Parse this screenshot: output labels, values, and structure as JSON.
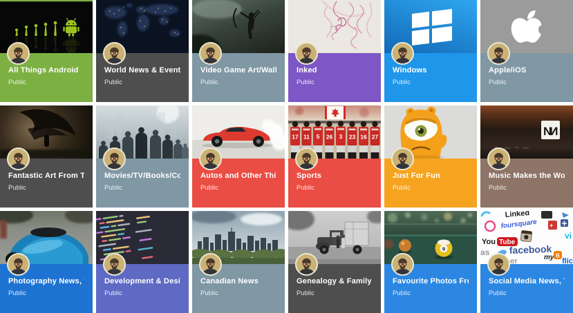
{
  "page": {
    "background": "#ffffff",
    "kind": "collections-grid"
  },
  "labels": {
    "visibility_public": "Public"
  },
  "avatar": {
    "alt": "profile photo of a man with glasses and beard"
  },
  "cards": [
    {
      "title": "All Things Android",
      "visibility": "Public",
      "accent": "#7CB043",
      "image_desc": "black wallpaper with green human-evolution silhouettes ending in Android robot"
    },
    {
      "title": "World News & Events",
      "visibility": "Public",
      "accent": "#4E4E4E",
      "image_desc": "dark world map at night with city lights"
    },
    {
      "title": "Video Game Art/Wallpapers",
      "visibility": "Public",
      "accent": "#8097A4",
      "image_desc": "Tomb Raider game art, heroine with bow in misty ruins"
    },
    {
      "title": "Inked",
      "visibility": "Public",
      "accent": "#7D57C5",
      "image_desc": "pink tattoo sketch line art on pale paper"
    },
    {
      "title": "Windows",
      "visibility": "Public",
      "accent": "#1F96EA",
      "image_desc": "white Windows logo on blue background"
    },
    {
      "title": "Apple/iOS",
      "visibility": "Public",
      "accent": "#8097A4",
      "image_desc": "white Apple logo on gray background"
    },
    {
      "title": "Fantastic Art From Talented...",
      "visibility": "Public",
      "accent": "#4E4E4E",
      "image_desc": "dark fantasy art of winged creature"
    },
    {
      "title": "Movies/TV/Books/Comics",
      "visibility": "Public",
      "accent": "#8097A4",
      "image_desc": "movie cast lineup against hazy city skyline"
    },
    {
      "title": "Autos and Other Things Tha...",
      "visibility": "Public",
      "accent": "#EA4D44",
      "image_desc": "red muscle car doing a burnout on white background"
    },
    {
      "title": "Sports",
      "visibility": "Public",
      "accent": "#EA4D44",
      "image_desc": "hockey team in red jerseys facing away under a Canada flag",
      "jersey_numbers": [
        "17",
        "11",
        "5",
        "26",
        "3",
        "23",
        "16",
        "27"
      ]
    },
    {
      "title": "Just For Fun",
      "visibility": "Public",
      "accent": "#F6A41F",
      "image_desc": "orange one-eyed monster toy"
    },
    {
      "title": "Music Makes the World Go '...",
      "visibility": "Public",
      "accent": "#8D7466",
      "image_desc": "dark textured album art with white NIN logo square",
      "logo_letter": "N"
    },
    {
      "title": "Photography News, Tips, & ...",
      "visibility": "Public",
      "accent": "#1E73D2",
      "image_desc": "fisheye photo of glossy blue sports car"
    },
    {
      "title": "Development & Design (Co...",
      "visibility": "Public",
      "accent": "#5F6AC4",
      "image_desc": "angled photo of CSS code on a dark editor screen"
    },
    {
      "title": "Canadian News",
      "visibility": "Public",
      "accent": "#8097A4",
      "image_desc": "city skyline under cloudy sky with green river valley"
    },
    {
      "title": "Genealogy & Family History",
      "visibility": "Public",
      "accent": "#4E4E4E",
      "image_desc": "old black-and-white photo of children beside a farm truck"
    },
    {
      "title": "Favourite Photos From Tale...",
      "visibility": "Public",
      "accent": "#2C87E2",
      "image_desc": "billiard balls on table with bokeh lights",
      "ball_number": "9"
    },
    {
      "title": "Social Media News, Tips, & ...",
      "visibility": "Public",
      "accent": "#2C87E2",
      "image_desc": "collage of social media logos",
      "words": {
        "linked": "Linked",
        "foursquare": "foursquare",
        "you": "You",
        "tube": "Tube",
        "facebook": "facebook",
        "gplus": "g+",
        "vi": "vi",
        "my": "my",
        "b": "B",
        "as": "as",
        "flic": "flic",
        "uber": "uber"
      }
    }
  ]
}
